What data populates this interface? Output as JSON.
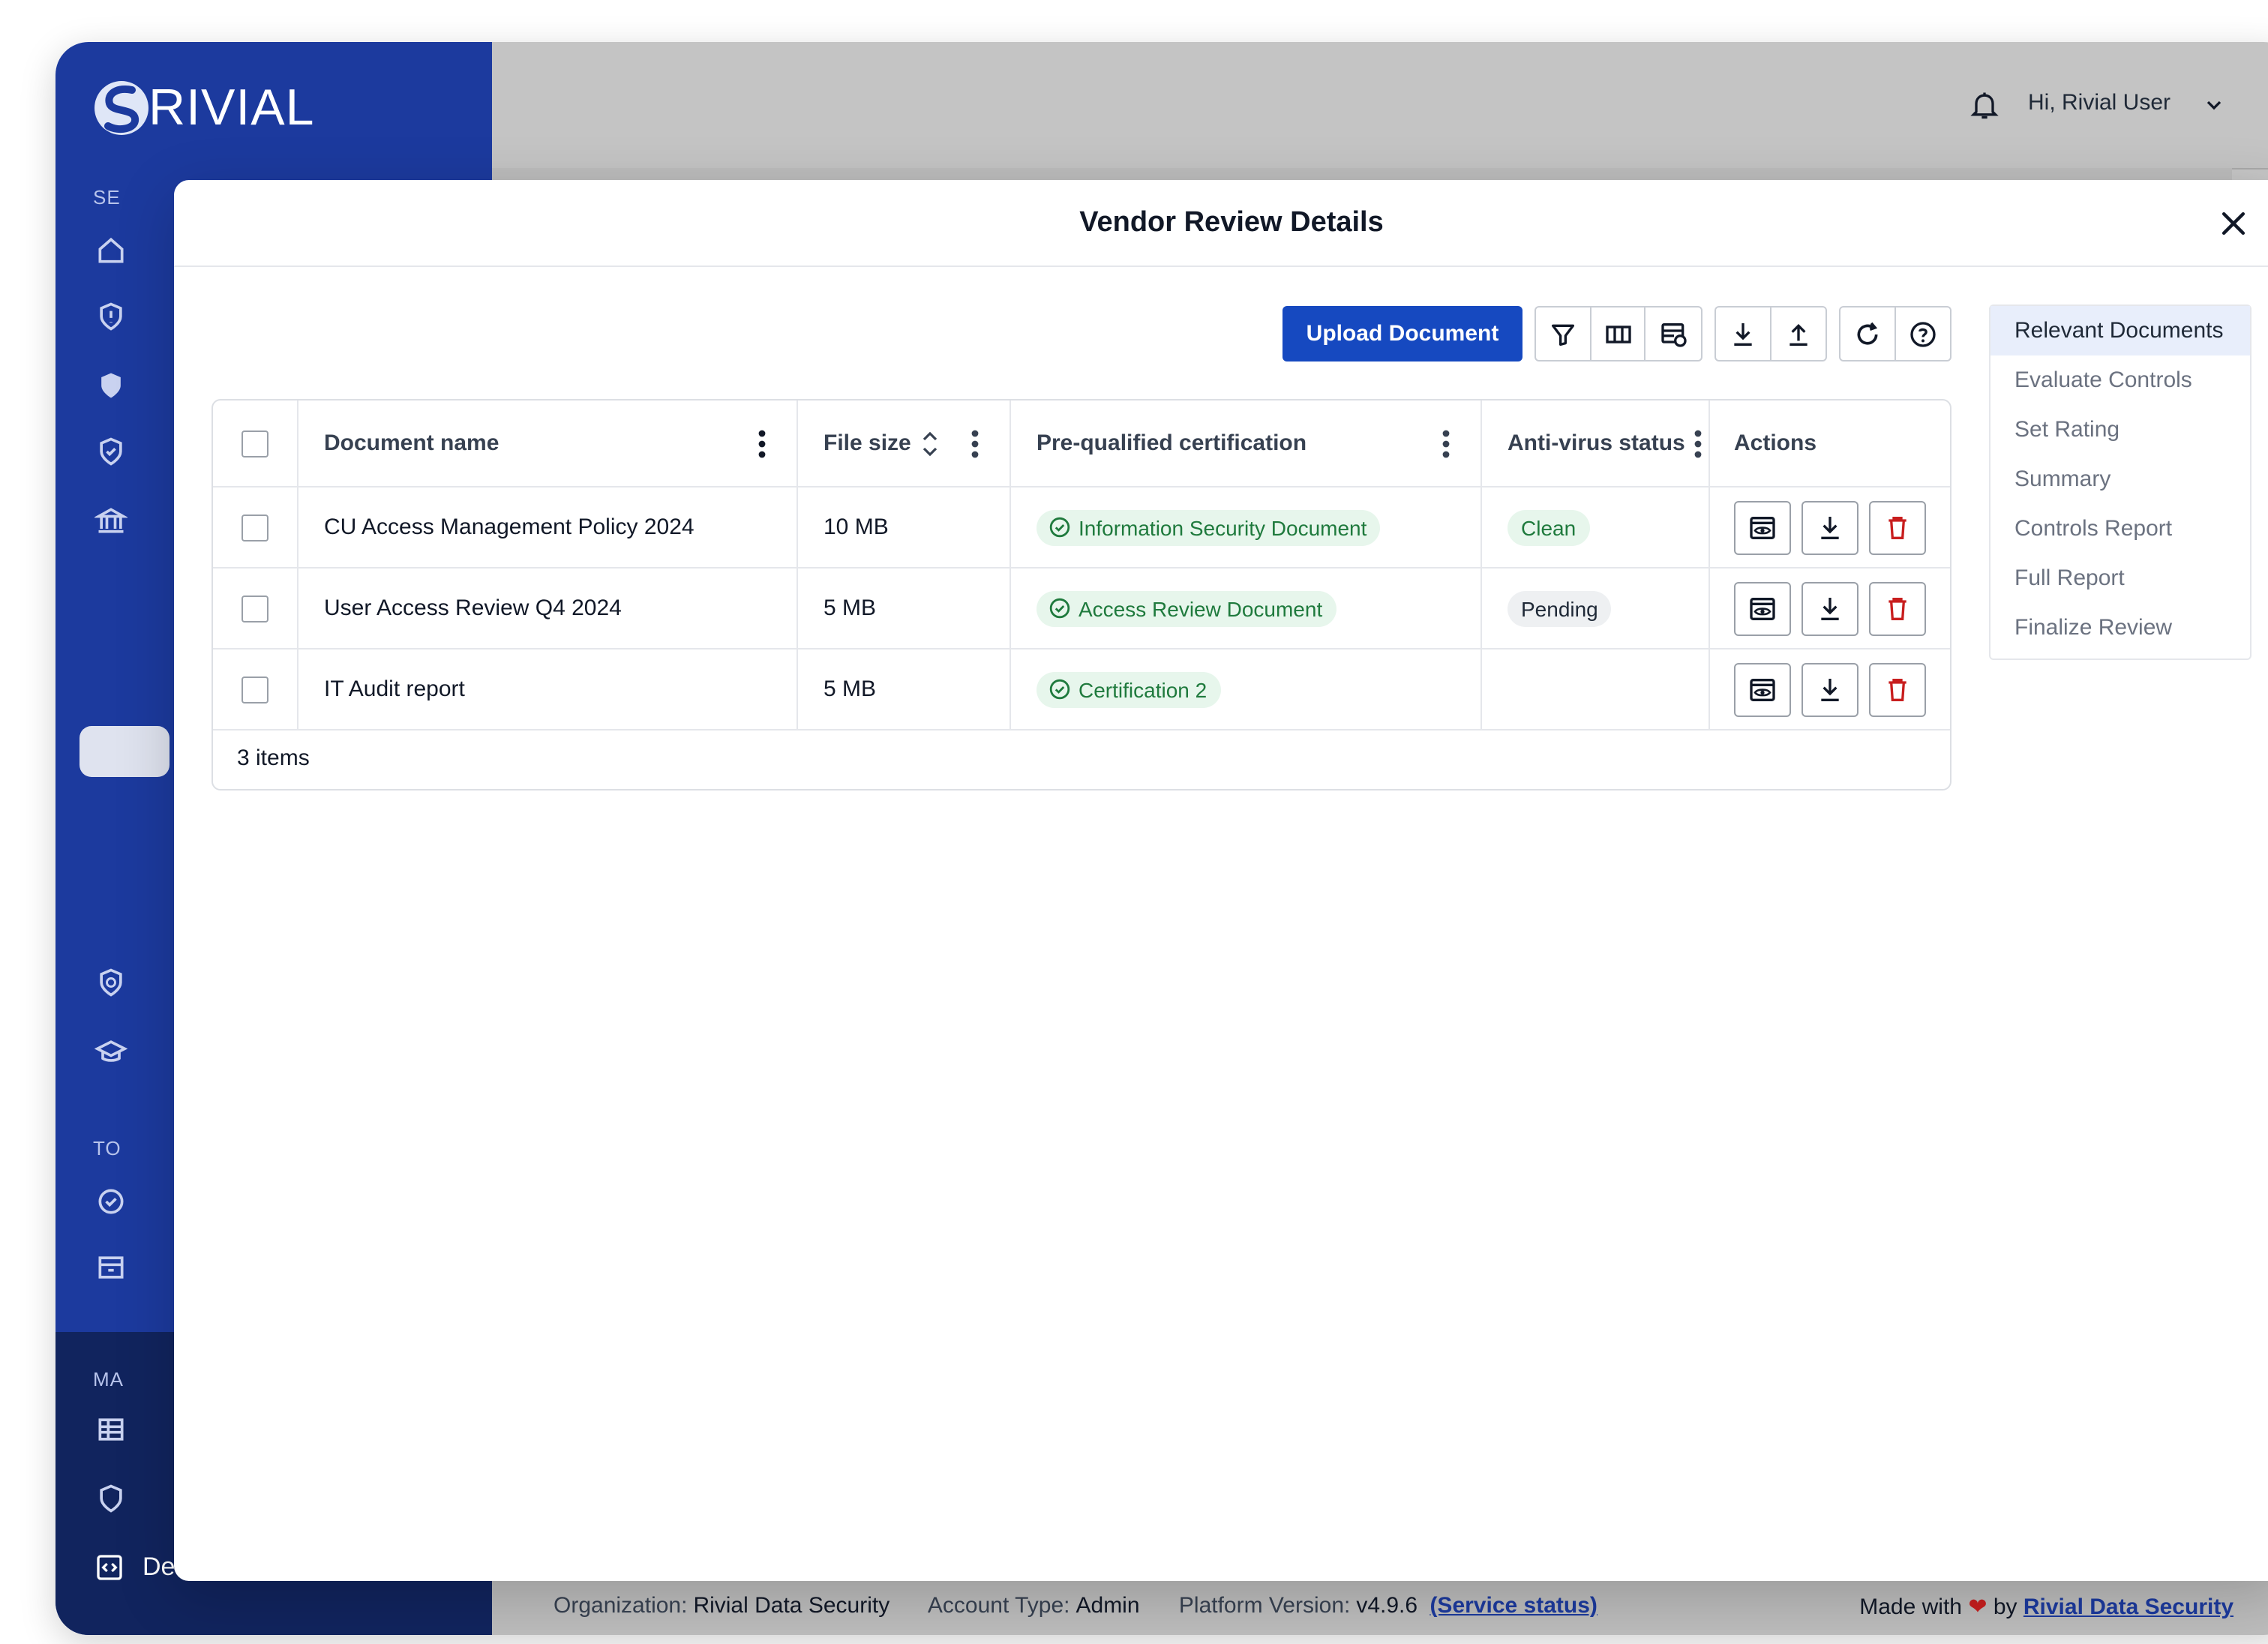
{
  "brand": {
    "name": "RIVIAL"
  },
  "sidebar": {
    "section_labels": [
      "SE",
      "TO",
      "MA"
    ],
    "development_label": "Development",
    "collapse_glyph": "> <"
  },
  "header": {
    "greeting": "Hi, Rivial User"
  },
  "modal": {
    "title": "Vendor Review Details",
    "upload_label": "Upload Document",
    "toolbar_icons": [
      "filter-icon",
      "columns-icon",
      "table-settings-icon",
      "download-icon",
      "upload-icon",
      "refresh-icon",
      "help-icon"
    ]
  },
  "grid": {
    "columns": [
      "Document name",
      "File size",
      "Pre-qualified certification",
      "Anti-virus status",
      "Actions"
    ],
    "rows": [
      {
        "name": "CU Access Management Policy 2024",
        "size": "10 MB",
        "certification": "Information Security Document",
        "av_status": "Clean"
      },
      {
        "name": "User Access Review Q4 2024",
        "size": "5 MB",
        "certification": "Access Review Document",
        "av_status": "Pending"
      },
      {
        "name": "IT Audit report",
        "size": "5 MB",
        "certification": "Certification 2",
        "av_status": ""
      }
    ],
    "footer": "3 items"
  },
  "steps": {
    "items": [
      "Relevant Documents",
      "Evaluate Controls",
      "Set Rating",
      "Summary",
      "Controls Report",
      "Full Report",
      "Finalize Review"
    ],
    "active": "Relevant Documents"
  },
  "footer": {
    "org_label": "Organization:",
    "org_value": "Rivial Data Security",
    "account_label": "Account Type:",
    "account_value": "Admin",
    "version_label": "Platform Version:",
    "version_value": "v4.9.6",
    "service_status": "(Service status)",
    "made_with": "Made with",
    "by": "by",
    "credit": "Rivial Data Security"
  },
  "colors": {
    "primary": "#1649c0",
    "sidebar": "#1c3a9e",
    "sidebar_dark": "#11245e",
    "success_bg": "#e7f6ec",
    "success_text": "#1f7a3d",
    "danger": "#c81e1e"
  }
}
